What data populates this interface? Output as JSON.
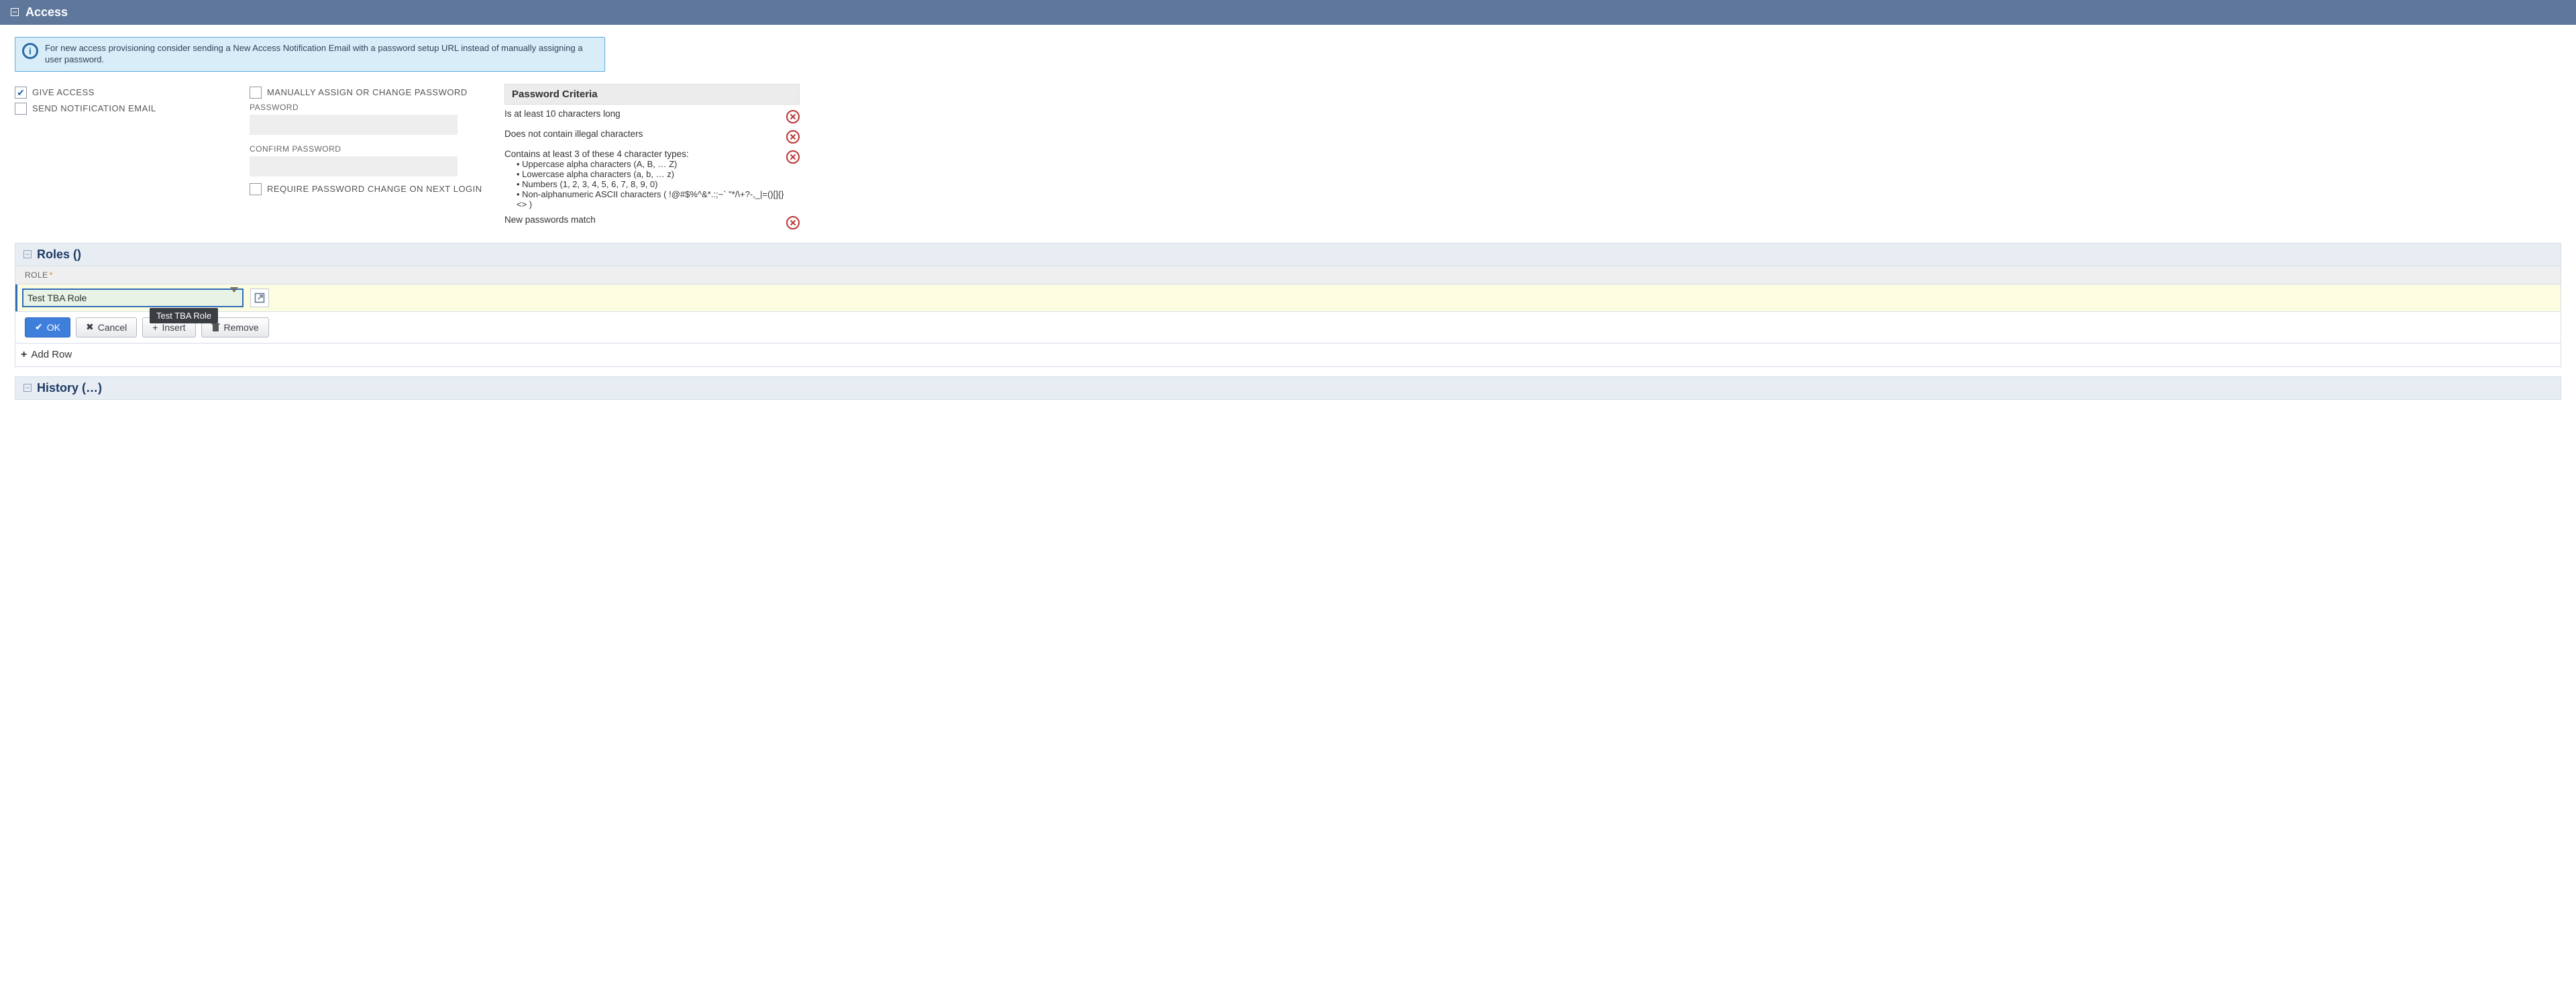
{
  "access": {
    "title": "Access",
    "info_text": "For new access provisioning consider sending a New Access Notification Email with a password setup URL instead of manually assigning a user password.",
    "checkboxes": {
      "give_access": {
        "label": "GIVE ACCESS",
        "checked": true
      },
      "send_notification": {
        "label": "SEND NOTIFICATION EMAIL",
        "checked": false
      },
      "manually_assign": {
        "label": "MANUALLY ASSIGN OR CHANGE PASSWORD",
        "checked": false
      },
      "require_change": {
        "label": "REQUIRE PASSWORD CHANGE ON NEXT LOGIN",
        "checked": false
      }
    },
    "password_label": "PASSWORD",
    "confirm_password_label": "CONFIRM PASSWORD",
    "criteria_header": "Password Criteria",
    "criteria": {
      "c1": "Is at least 10 characters long",
      "c2": "Does not contain illegal characters",
      "c3": "Contains at least 3 of these 4 character types:",
      "c3a": "• Uppercase alpha characters (A, B, … Z)",
      "c3b": "• Lowercase alpha characters (a, b, … z)",
      "c3c": "• Numbers (1, 2, 3, 4, 5, 6, 7, 8, 9, 0)",
      "c3d": "• Non-alphanumeric ASCII characters ( !@#$%^&*.:;~` \"*/\\+?-,_|=()[]{}<> )",
      "c4": "New passwords match"
    }
  },
  "roles": {
    "title": "Roles ()",
    "field_label": "ROLE",
    "value": "Test TBA Role",
    "tooltip": "Test TBA Role",
    "buttons": {
      "ok": "OK",
      "cancel": "Cancel",
      "insert": "Insert",
      "remove": "Remove"
    },
    "add_row": "Add Row"
  },
  "history": {
    "title": "History (…)"
  }
}
